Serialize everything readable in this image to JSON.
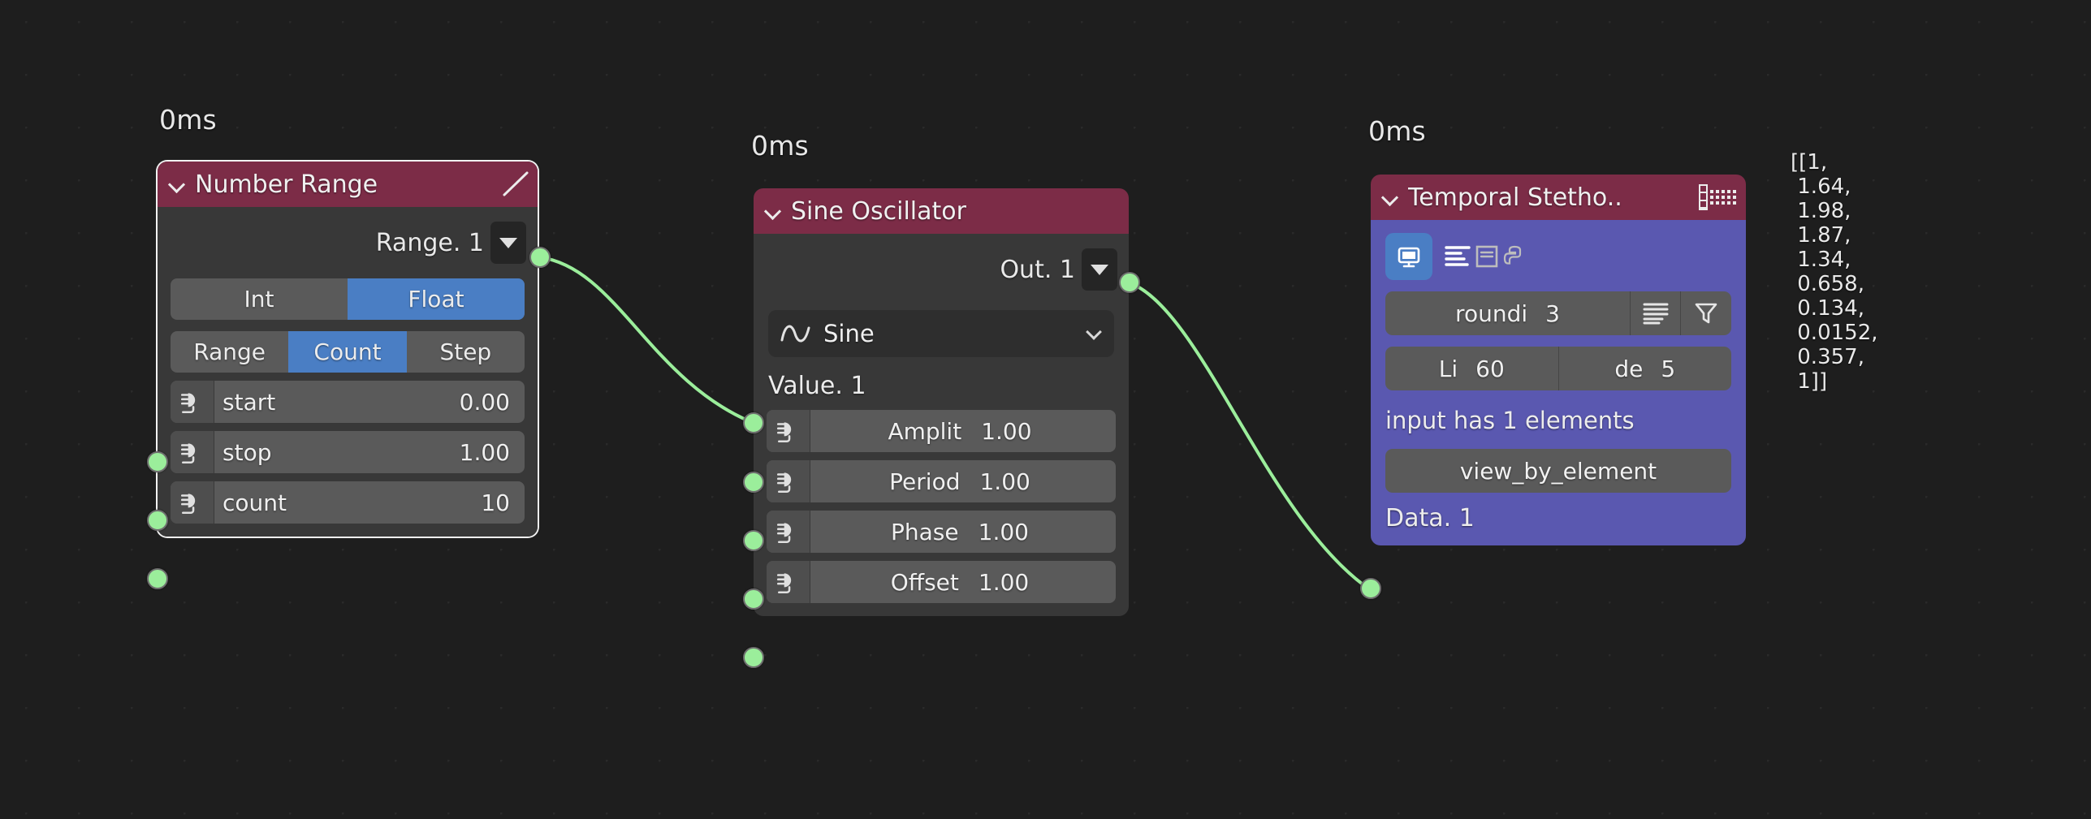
{
  "canvas": {
    "background_color": "#1e1e1e",
    "grid_dot_color": "#2a2a2a",
    "link_color": "#9bee9b",
    "socket_color": "#9bee9b",
    "header_color": "#7c2c47",
    "body_color": "#383838",
    "accent_blue": "#4a7ec4",
    "purple_body": "#5a58b0"
  },
  "timings": {
    "number_range": "0ms",
    "sine_oscillator": "0ms",
    "temporal_stethoscope": "0ms"
  },
  "nodes": {
    "number_range": {
      "title": "Number Range",
      "header_icon": "ramp-icon",
      "collapse_icon": "chevron-down-icon",
      "output": {
        "label": "Range. 1",
        "dropdown_icon": "triangle-down-icon"
      },
      "type_toggle": {
        "options": [
          "Int",
          "Float"
        ],
        "selected": "Float"
      },
      "mode_toggle": {
        "options": [
          "Range",
          "Count",
          "Step"
        ],
        "selected": "Count"
      },
      "properties": [
        {
          "name": "start",
          "value": "0.00"
        },
        {
          "name": "stop",
          "value": "1.00"
        },
        {
          "name": "count",
          "value": "10"
        }
      ]
    },
    "sine_oscillator": {
      "title": "Sine Oscillator",
      "collapse_icon": "chevron-down-icon",
      "output": {
        "label": "Out. 1",
        "dropdown_icon": "triangle-down-icon"
      },
      "waveform_select": {
        "value": "Sine",
        "icon": "sine-wave-icon",
        "caret": "chevron-down-icon"
      },
      "input_label": "Value. 1",
      "properties": [
        {
          "name": "Amplit",
          "value": "1.00"
        },
        {
          "name": "Period",
          "value": "1.00"
        },
        {
          "name": "Phase",
          "value": "1.00"
        },
        {
          "name": "Offset",
          "value": "1.00"
        }
      ]
    },
    "temporal_stethoscope": {
      "title": "Temporal Stetho..",
      "collapse_icon": "chevron-down-icon",
      "header_icon": "grid-table-icon",
      "toolbar": {
        "display_toggle": {
          "icon": "monitor-icon",
          "active": true
        },
        "text_view": {
          "icon": "text-lines-icon",
          "active": true
        },
        "card_view": {
          "icon": "card-icon",
          "active": false
        },
        "python_view": {
          "icon": "python-icon",
          "active": false
        },
        "color_field": {
          "icon": "color-swatch",
          "color": "#fbfbfb"
        }
      },
      "rounding_row": {
        "label": "roundi",
        "value": "3",
        "list_icon": "list-lines-icon",
        "filter_icon": "funnel-icon"
      },
      "limit_row": [
        {
          "label": "Li",
          "value": "60"
        },
        {
          "label": "de",
          "value": "5"
        }
      ],
      "info": "input has 1 elements",
      "action_button": "view_by_element",
      "input_label": "Data. 1"
    }
  },
  "readout": "[[1,\n 1.64,\n 1.98,\n 1.87,\n 1.34,\n 0.658,\n 0.134,\n 0.0152,\n 0.357,\n 1]]",
  "readout_values": [
    1,
    1.64,
    1.98,
    1.87,
    1.34,
    0.658,
    0.134,
    0.0152,
    0.357,
    1
  ]
}
